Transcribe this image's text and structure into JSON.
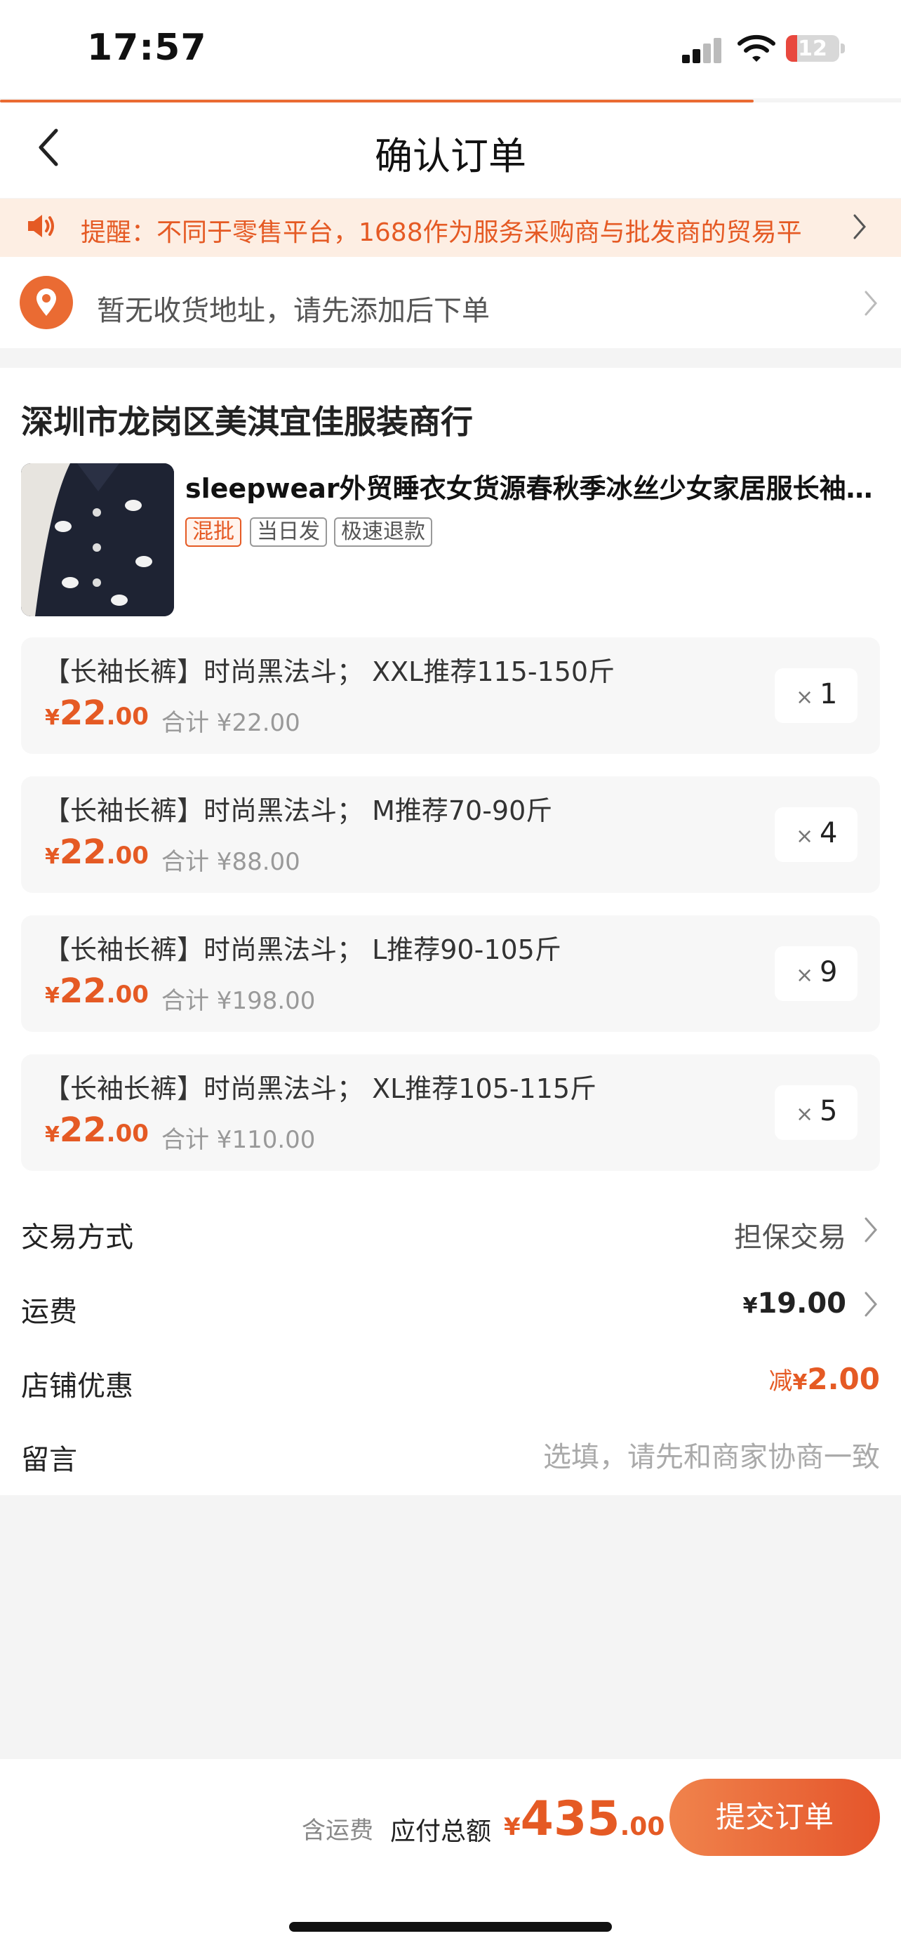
{
  "status_bar": {
    "time": "17:57",
    "battery": "12"
  },
  "nav": {
    "title": "确认订单"
  },
  "notice": {
    "text": "提醒：不同于零售平台，1688作为服务采购商与批发商的贸易平"
  },
  "address": {
    "text": "暂无收货地址，请先添加后下单"
  },
  "shop": {
    "name": "深圳市龙岗区美淇宜佳服装商行",
    "product_title": "sleepwear外贸睡衣女货源春秋季冰丝少女家居服长袖…",
    "tags": [
      "混批",
      "当日发",
      "极速退款"
    ]
  },
  "skus": [
    {
      "name": "【长袖长裤】时尚黑法斗； XXL推荐115-150斤",
      "currency": "¥",
      "price_int": "22",
      "price_dec": ".00",
      "subtotal": "合计 ¥22.00",
      "qty_x": "×",
      "qty": "1"
    },
    {
      "name": "【长袖长裤】时尚黑法斗； M推荐70-90斤",
      "currency": "¥",
      "price_int": "22",
      "price_dec": ".00",
      "subtotal": "合计 ¥88.00",
      "qty_x": "×",
      "qty": "4"
    },
    {
      "name": "【长袖长裤】时尚黑法斗； L推荐90-105斤",
      "currency": "¥",
      "price_int": "22",
      "price_dec": ".00",
      "subtotal": "合计 ¥198.00",
      "qty_x": "×",
      "qty": "9"
    },
    {
      "name": "【长袖长裤】时尚黑法斗； XL推荐105-115斤",
      "currency": "¥",
      "price_int": "22",
      "price_dec": ".00",
      "subtotal": "合计 ¥110.00",
      "qty_x": "×",
      "qty": "5"
    }
  ],
  "rows": {
    "trade_label": "交易方式",
    "trade_value": "担保交易",
    "shipping_label": "运费",
    "shipping_currency": "¥",
    "shipping_value": "19.00",
    "discount_label": "店铺优惠",
    "discount_prefix": "减",
    "discount_currency": "¥",
    "discount_value": "2.00",
    "note_label": "留言",
    "note_placeholder": "选填，请先和商家协商一致"
  },
  "bottom": {
    "includes_shipping": "含运费",
    "total_label": "应付总额",
    "currency": "¥",
    "total_int": "435",
    "total_dec": ".00",
    "submit": "提交订单"
  }
}
